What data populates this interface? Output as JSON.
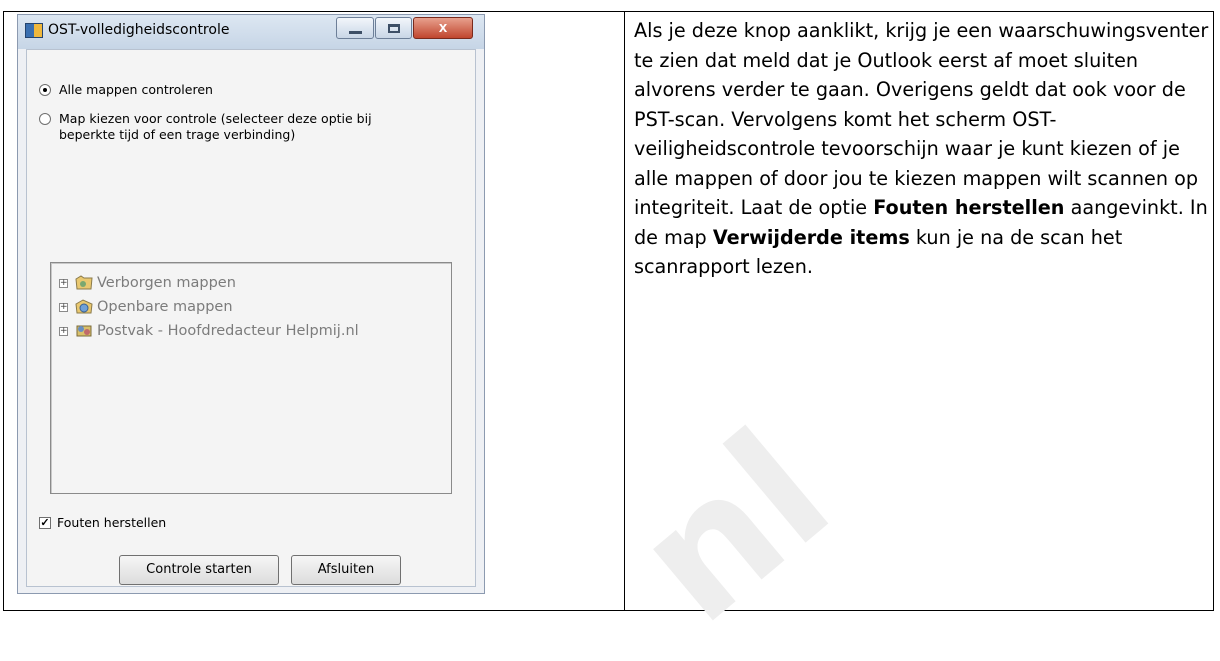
{
  "dialog": {
    "title": "OST-volledigheidscontrole",
    "close_glyph": "x",
    "option_all": "Alle mappen controleren",
    "option_choose": "Map kiezen voor controle (selecteer deze optie bij beperkte tijd of een trage verbinding)",
    "selected_option": "option_all",
    "tree_items": [
      "Verborgen mappen",
      "Openbare mappen",
      "Postvak - Hoofdredacteur Helpmij.nl"
    ],
    "fix_errors_label": "Fouten herstellen",
    "fix_errors_checked": true,
    "start_button": "Controle starten",
    "close_button": "Afsluiten"
  },
  "description": {
    "part1": "Als je deze knop aanklikt, krijg je een waarschuwingsventer te zien dat meld dat je Outlook eerst af moet sluiten alvorens verder te gaan. Overigens geldt dat ook voor de PST-scan. Vervolgens komt het scherm OST-veiligheidscontrole tevoorschijn waar je kunt kiezen of je alle mappen of door jou te kiezen mappen wilt scannen op integriteit. Laat de optie ",
    "bold1": "Fouten herstellen",
    "part2": " aangevinkt. In de map ",
    "bold2": "Verwijderde items",
    "part3": " kun je na de scan het scanrapport lezen."
  },
  "watermark_text": "nl",
  "colors": {
    "heading_partial": "#2a5d9a",
    "watermark": "#eeeeee"
  }
}
